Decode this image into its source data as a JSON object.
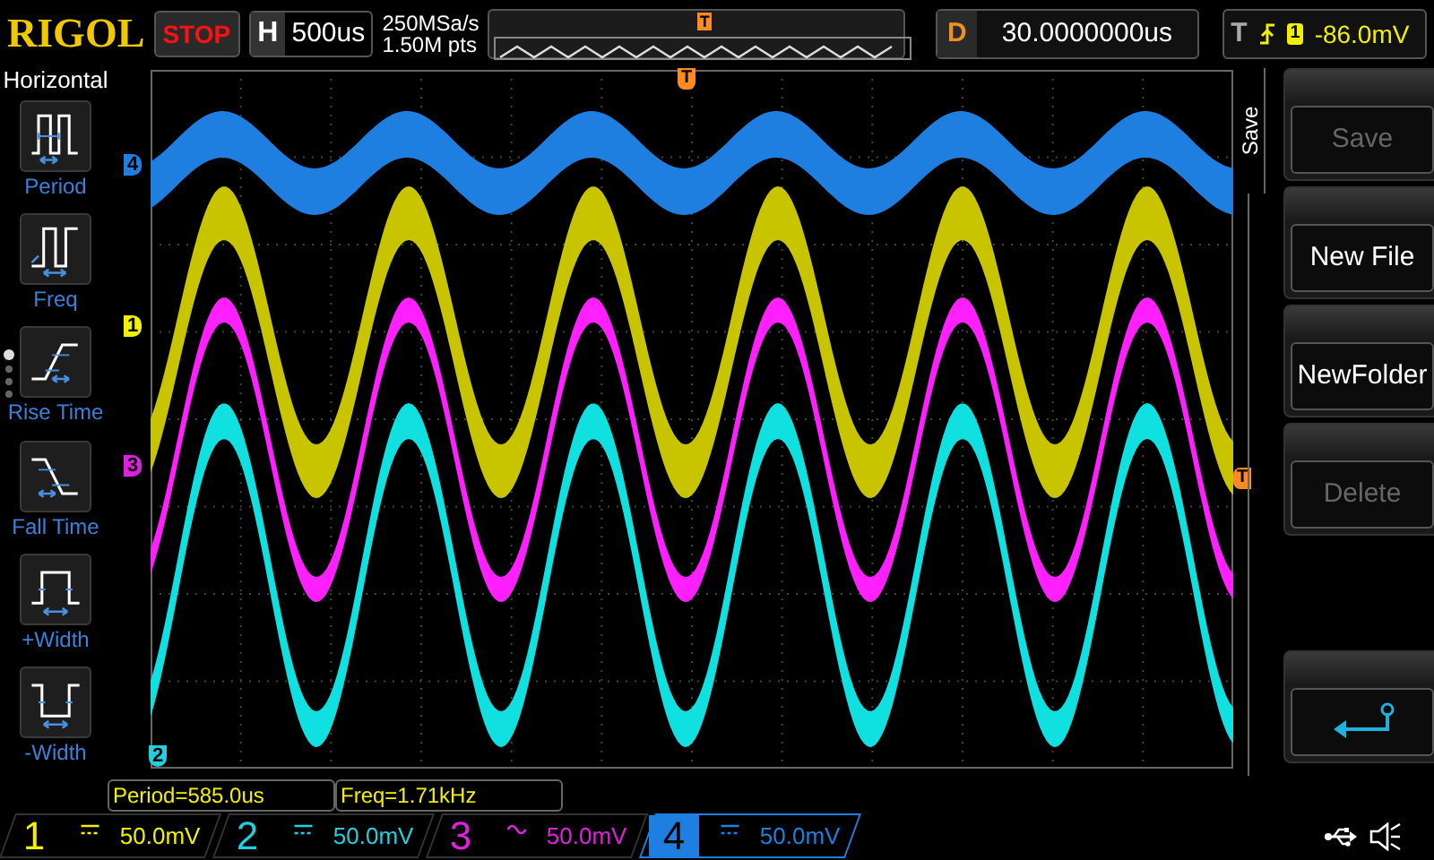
{
  "header": {
    "logo": "RIGOL",
    "run_state": "STOP",
    "timebase_label": "H",
    "timebase": "500us",
    "sample_rate": "250MSa/s",
    "memory_depth": "1.50M pts",
    "overview_trigger": "T",
    "delay_label": "D",
    "delay": "30.0000000us",
    "trigger_label": "T",
    "trigger_source": "1",
    "trigger_level": "-86.0mV"
  },
  "left_menu": {
    "title": "Horizontal",
    "items": [
      {
        "label": "Period",
        "kind": "period"
      },
      {
        "label": "Freq",
        "kind": "freq"
      },
      {
        "label": "Rise Time",
        "kind": "rise"
      },
      {
        "label": "Fall Time",
        "kind": "fall"
      },
      {
        "label": "+Width",
        "kind": "pwidth"
      },
      {
        "label": "-Width",
        "kind": "nwidth"
      }
    ],
    "pages": [
      {
        "selected": true
      },
      {
        "selected": false
      },
      {
        "selected": false
      },
      {
        "selected": false
      }
    ]
  },
  "channel_markers": [
    {
      "label": "4",
      "color": "#1e7fe0"
    },
    {
      "label": "1",
      "color": "#f0f000"
    },
    {
      "label": "3",
      "color": "#e020e0"
    },
    {
      "label": "2",
      "color": "#20d0e0"
    }
  ],
  "trigger_markers": [
    "T",
    "T"
  ],
  "right_menu": {
    "title": "Save",
    "items": [
      {
        "kind": "text",
        "label": "Save",
        "disabled": true
      },
      {
        "kind": "text",
        "label": "New File",
        "disabled": false
      },
      {
        "kind": "text",
        "label": "NewFolder",
        "disabled": false
      },
      {
        "kind": "text",
        "label": "Delete",
        "disabled": true
      },
      {
        "kind": "return"
      }
    ]
  },
  "measurements": [
    "Period=585.0us",
    "Freq=1.71kHz"
  ],
  "channels": [
    {
      "number": "1",
      "kind": "dc",
      "scale": "50.0mV",
      "color": "#f0f000",
      "selected": false
    },
    {
      "number": "2",
      "kind": "dc",
      "scale": "50.0mV",
      "color": "#20d0e0",
      "selected": false
    },
    {
      "number": "3",
      "kind": "ac",
      "scale": "50.0mV",
      "color": "#e020e0",
      "selected": false
    },
    {
      "number": "4",
      "kind": "dc",
      "scale": "50.0mV",
      "color": "#1e7fe0",
      "selected": true
    }
  ]
}
